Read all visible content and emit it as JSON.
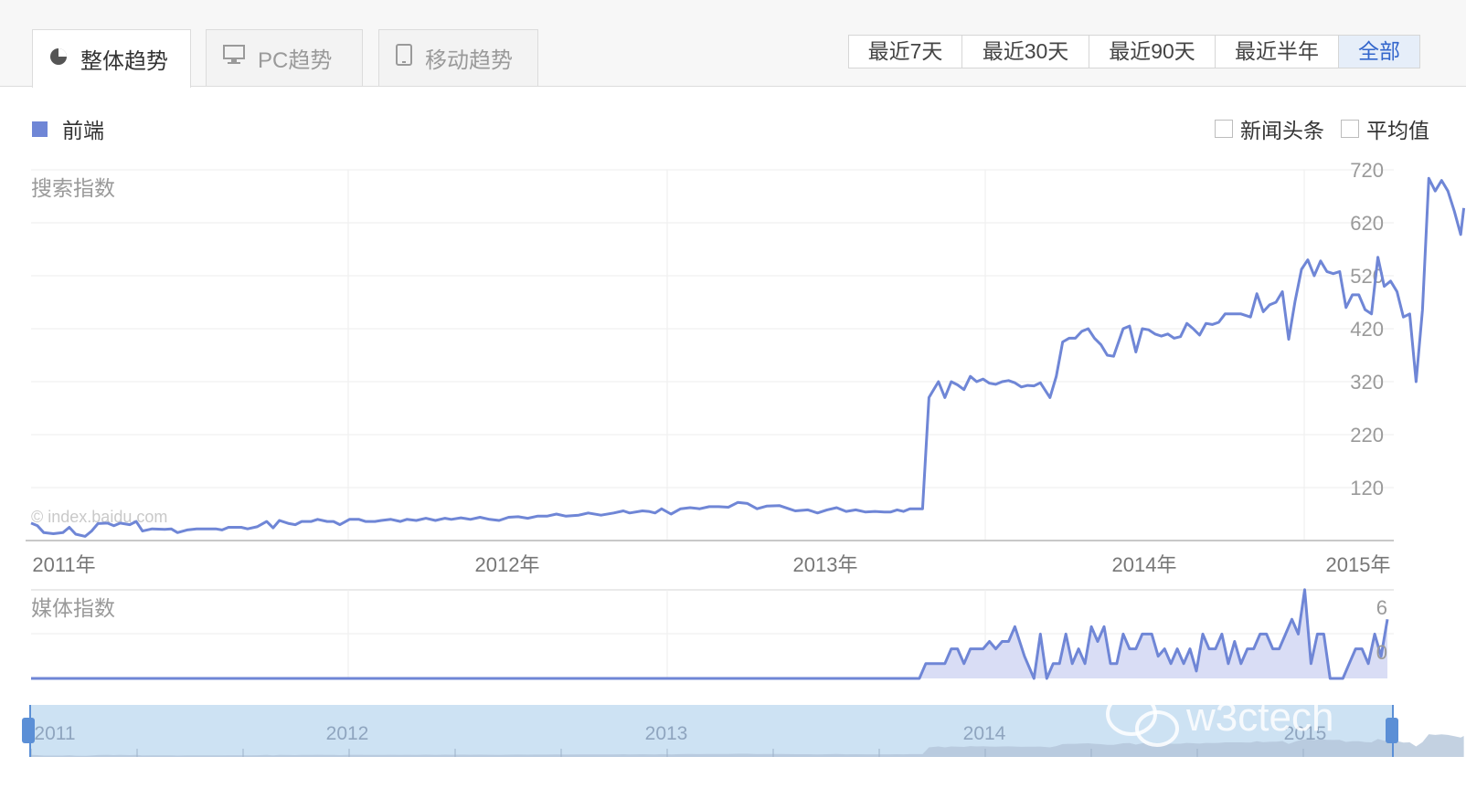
{
  "tabs": [
    {
      "label": "整体趋势",
      "icon": "pie-chart-icon",
      "active": true
    },
    {
      "label": "PC趋势",
      "icon": "monitor-icon",
      "active": false
    },
    {
      "label": "移动趋势",
      "icon": "mobile-icon",
      "active": false
    }
  ],
  "ranges": [
    {
      "label": "最近7天",
      "active": false
    },
    {
      "label": "最近30天",
      "active": false
    },
    {
      "label": "最近90天",
      "active": false
    },
    {
      "label": "最近半年",
      "active": false
    },
    {
      "label": "全部",
      "active": true
    }
  ],
  "legend": {
    "label": "前端",
    "color": "#6f86d6"
  },
  "options": {
    "news_label": "新闻头条",
    "avg_label": "平均值"
  },
  "watermark": "© index.baidu.com",
  "brand_watermark": "w3ctech",
  "colors": {
    "series": "#6f86d6",
    "media_fill": "#d9ddf5",
    "navigator_bg": "#cde2f3",
    "navigator_handle": "#5b8fd6",
    "active_range": "#3366cc"
  },
  "chart_data": [
    {
      "type": "line",
      "title": "搜索指数",
      "y_ticks": [
        120,
        220,
        320,
        420,
        520,
        620,
        720
      ],
      "ylim": [
        20,
        720
      ],
      "x_labels": [
        "2011年",
        "2012年",
        "2013年",
        "2014年",
        "2015年"
      ],
      "xlim": [
        2011.0,
        2015.28
      ],
      "grid": true,
      "series": [
        {
          "name": "前端",
          "points": [
            [
              2011.0,
              53
            ],
            [
              2011.02,
              48
            ],
            [
              2011.04,
              35
            ],
            [
              2011.07,
              33
            ],
            [
              2011.1,
              35
            ],
            [
              2011.12,
              45
            ],
            [
              2011.14,
              32
            ],
            [
              2011.17,
              28
            ],
            [
              2011.19,
              38
            ],
            [
              2011.21,
              52
            ],
            [
              2011.24,
              53
            ],
            [
              2011.26,
              48
            ],
            [
              2011.28,
              53
            ],
            [
              2011.31,
              50
            ],
            [
              2011.33,
              56
            ],
            [
              2011.35,
              38
            ],
            [
              2011.38,
              42
            ],
            [
              2011.42,
              41
            ],
            [
              2011.44,
              42
            ],
            [
              2011.46,
              35
            ],
            [
              2011.49,
              40
            ],
            [
              2011.52,
              42
            ],
            [
              2011.55,
              42
            ],
            [
              2011.58,
              42
            ],
            [
              2011.6,
              40
            ],
            [
              2011.62,
              45
            ],
            [
              2011.66,
              45
            ],
            [
              2011.68,
              42
            ],
            [
              2011.71,
              46
            ],
            [
              2011.74,
              56
            ],
            [
              2011.76,
              44
            ],
            [
              2011.78,
              58
            ],
            [
              2011.81,
              52
            ],
            [
              2011.83,
              50
            ],
            [
              2011.85,
              56
            ],
            [
              2011.88,
              56
            ],
            [
              2011.9,
              60
            ],
            [
              2011.93,
              56
            ],
            [
              2011.95,
              56
            ],
            [
              2011.97,
              50
            ],
            [
              2012.0,
              60
            ],
            [
              2012.03,
              60
            ],
            [
              2012.05,
              56
            ],
            [
              2012.08,
              56
            ],
            [
              2012.1,
              58
            ],
            [
              2012.13,
              60
            ],
            [
              2012.16,
              56
            ],
            [
              2012.18,
              60
            ],
            [
              2012.21,
              58
            ],
            [
              2012.24,
              62
            ],
            [
              2012.27,
              58
            ],
            [
              2012.3,
              62
            ],
            [
              2012.32,
              60
            ],
            [
              2012.35,
              63
            ],
            [
              2012.38,
              60
            ],
            [
              2012.41,
              64
            ],
            [
              2012.44,
              60
            ],
            [
              2012.47,
              58
            ],
            [
              2012.5,
              64
            ],
            [
              2012.53,
              65
            ],
            [
              2012.56,
              62
            ],
            [
              2012.59,
              66
            ],
            [
              2012.62,
              66
            ],
            [
              2012.65,
              70
            ],
            [
              2012.68,
              66
            ],
            [
              2012.72,
              68
            ],
            [
              2012.75,
              72
            ],
            [
              2012.79,
              68
            ],
            [
              2012.83,
              72
            ],
            [
              2012.86,
              76
            ],
            [
              2012.88,
              72
            ],
            [
              2012.92,
              76
            ],
            [
              2012.94,
              75
            ],
            [
              2012.96,
              72
            ],
            [
              2012.98,
              80
            ],
            [
              2013.01,
              70
            ],
            [
              2013.04,
              80
            ],
            [
              2013.07,
              82
            ],
            [
              2013.1,
              80
            ],
            [
              2013.13,
              84
            ],
            [
              2013.16,
              84
            ],
            [
              2013.19,
              83
            ],
            [
              2013.22,
              92
            ],
            [
              2013.25,
              90
            ],
            [
              2013.28,
              80
            ],
            [
              2013.31,
              85
            ],
            [
              2013.35,
              86
            ],
            [
              2013.38,
              80
            ],
            [
              2013.4,
              76
            ],
            [
              2013.44,
              78
            ],
            [
              2013.47,
              72
            ],
            [
              2013.5,
              78
            ],
            [
              2013.53,
              82
            ],
            [
              2013.56,
              75
            ],
            [
              2013.59,
              78
            ],
            [
              2013.62,
              74
            ],
            [
              2013.65,
              75
            ],
            [
              2013.68,
              74
            ],
            [
              2013.7,
              74
            ],
            [
              2013.72,
              78
            ],
            [
              2013.74,
              75
            ],
            [
              2013.76,
              80
            ],
            [
              2013.8,
              80
            ],
            [
              2013.82,
              290
            ],
            [
              2013.85,
              320
            ],
            [
              2013.87,
              290
            ],
            [
              2013.89,
              320
            ],
            [
              2013.91,
              314
            ],
            [
              2013.93,
              305
            ],
            [
              2013.95,
              330
            ],
            [
              2013.97,
              320
            ],
            [
              2013.99,
              325
            ],
            [
              2014.01,
              317
            ],
            [
              2014.03,
              315
            ],
            [
              2014.05,
              320
            ],
            [
              2014.07,
              322
            ],
            [
              2014.09,
              318
            ],
            [
              2014.11,
              310
            ],
            [
              2014.13,
              313
            ],
            [
              2014.15,
              312
            ],
            [
              2014.17,
              318
            ],
            [
              2014.2,
              290
            ],
            [
              2014.22,
              330
            ],
            [
              2014.24,
              395
            ],
            [
              2014.26,
              402
            ],
            [
              2014.28,
              402
            ],
            [
              2014.3,
              415
            ],
            [
              2014.32,
              420
            ],
            [
              2014.34,
              402
            ],
            [
              2014.36,
              390
            ],
            [
              2014.38,
              370
            ],
            [
              2014.4,
              368
            ],
            [
              2014.43,
              420
            ],
            [
              2014.45,
              425
            ],
            [
              2014.47,
              376
            ],
            [
              2014.49,
              420
            ],
            [
              2014.51,
              418
            ],
            [
              2014.53,
              410
            ],
            [
              2014.55,
              406
            ],
            [
              2014.57,
              410
            ],
            [
              2014.59,
              402
            ],
            [
              2014.61,
              405
            ],
            [
              2014.63,
              430
            ],
            [
              2014.65,
              420
            ],
            [
              2014.67,
              408
            ],
            [
              2014.69,
              430
            ],
            [
              2014.71,
              428
            ],
            [
              2014.73,
              432
            ],
            [
              2014.75,
              448
            ],
            [
              2014.77,
              448
            ],
            [
              2014.8,
              448
            ],
            [
              2014.83,
              442
            ],
            [
              2014.85,
              486
            ],
            [
              2014.87,
              452
            ],
            [
              2014.89,
              465
            ],
            [
              2014.91,
              470
            ],
            [
              2014.93,
              490
            ],
            [
              2014.95,
              400
            ],
            [
              2014.97,
              472
            ],
            [
              2014.99,
              532
            ],
            [
              2015.01,
              550
            ],
            [
              2015.03,
              520
            ],
            [
              2015.05,
              548
            ],
            [
              2015.07,
              528
            ],
            [
              2015.09,
              524
            ],
            [
              2015.11,
              528
            ],
            [
              2015.13,
              460
            ],
            [
              2015.15,
              484
            ],
            [
              2015.17,
              484
            ],
            [
              2015.19,
              456
            ],
            [
              2015.21,
              448
            ],
            [
              2015.23,
              555
            ],
            [
              2015.25,
              500
            ],
            [
              2015.27,
              510
            ],
            [
              2015.29,
              490
            ],
            [
              2015.31,
              442
            ],
            [
              2015.33,
              448
            ],
            [
              2015.35,
              320
            ],
            [
              2015.37,
              456
            ],
            [
              2015.39,
              704
            ],
            [
              2015.41,
              680
            ],
            [
              2015.43,
              700
            ],
            [
              2015.45,
              680
            ],
            [
              2015.47,
              642
            ],
            [
              2015.49,
              598
            ],
            [
              2015.5,
              648
            ]
          ]
        }
      ]
    },
    {
      "type": "area",
      "title": "媒体指数",
      "y_ticks": [
        0,
        6
      ],
      "ylim": [
        0,
        6
      ],
      "xlim": [
        2011.0,
        2015.28
      ],
      "grid": true,
      "series": [
        {
          "name": "前端",
          "points": [
            [
              2011.0,
              0
            ],
            [
              2013.79,
              0
            ],
            [
              2013.81,
              2
            ],
            [
              2013.87,
              2
            ],
            [
              2013.89,
              4
            ],
            [
              2013.91,
              4
            ],
            [
              2013.93,
              2
            ],
            [
              2013.95,
              4
            ],
            [
              2013.99,
              4
            ],
            [
              2014.01,
              5
            ],
            [
              2014.03,
              4
            ],
            [
              2014.05,
              5
            ],
            [
              2014.07,
              5
            ],
            [
              2014.09,
              7
            ],
            [
              2014.12,
              3
            ],
            [
              2014.15,
              0
            ],
            [
              2014.17,
              6
            ],
            [
              2014.19,
              0
            ],
            [
              2014.21,
              2
            ],
            [
              2014.23,
              2
            ],
            [
              2014.25,
              6
            ],
            [
              2014.27,
              2
            ],
            [
              2014.29,
              4
            ],
            [
              2014.31,
              2
            ],
            [
              2014.33,
              7
            ],
            [
              2014.35,
              5
            ],
            [
              2014.37,
              7
            ],
            [
              2014.39,
              2
            ],
            [
              2014.41,
              2
            ],
            [
              2014.43,
              6
            ],
            [
              2014.45,
              4
            ],
            [
              2014.47,
              4
            ],
            [
              2014.49,
              6
            ],
            [
              2014.52,
              6
            ],
            [
              2014.54,
              3
            ],
            [
              2014.56,
              4
            ],
            [
              2014.58,
              2
            ],
            [
              2014.6,
              4
            ],
            [
              2014.62,
              2
            ],
            [
              2014.64,
              4
            ],
            [
              2014.66,
              1
            ],
            [
              2014.68,
              6
            ],
            [
              2014.7,
              4
            ],
            [
              2014.72,
              4
            ],
            [
              2014.74,
              6
            ],
            [
              2014.76,
              2
            ],
            [
              2014.78,
              5
            ],
            [
              2014.8,
              2
            ],
            [
              2014.82,
              4
            ],
            [
              2014.84,
              4
            ],
            [
              2014.86,
              6
            ],
            [
              2014.88,
              6
            ],
            [
              2014.9,
              4
            ],
            [
              2014.92,
              4
            ],
            [
              2014.94,
              6
            ],
            [
              2014.96,
              8
            ],
            [
              2014.98,
              6
            ],
            [
              2015.0,
              12
            ],
            [
              2015.02,
              2
            ],
            [
              2015.04,
              6
            ],
            [
              2015.06,
              6
            ],
            [
              2015.08,
              0
            ],
            [
              2015.12,
              0
            ],
            [
              2015.14,
              2
            ],
            [
              2015.16,
              4
            ],
            [
              2015.18,
              4
            ],
            [
              2015.2,
              2
            ],
            [
              2015.22,
              6
            ],
            [
              2015.24,
              3
            ],
            [
              2015.26,
              8
            ]
          ]
        }
      ]
    }
  ],
  "navigator": {
    "labels": [
      "2011",
      "2012",
      "2013",
      "2014",
      "2015"
    ]
  }
}
